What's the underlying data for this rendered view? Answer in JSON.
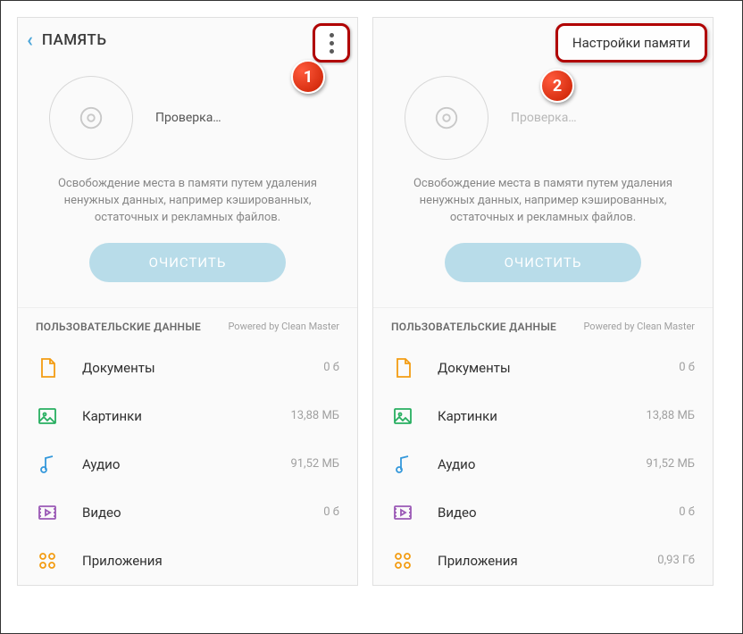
{
  "callouts": {
    "one": "1",
    "two": "2"
  },
  "left": {
    "header": {
      "title": "ПАМЯТЬ"
    },
    "status": "Проверка…",
    "description": "Освобождение места в памяти путем удаления ненужных данных, например кэшированных, остаточных и рекламных файлов.",
    "clean_button": "ОЧИСТИТЬ",
    "section": {
      "title": "ПОЛЬЗОВАТЕЛЬСКИЕ ДАННЫЕ",
      "powered": "Powered by Clean Master"
    },
    "items": [
      {
        "label": "Документы",
        "size": "0 б"
      },
      {
        "label": "Картинки",
        "size": "13,88 МБ"
      },
      {
        "label": "Аудио",
        "size": "91,52 МБ"
      },
      {
        "label": "Видео",
        "size": "0 б"
      },
      {
        "label": "Приложения",
        "size": ""
      }
    ]
  },
  "right": {
    "menu_item": "Настройки памяти",
    "status": "Проверка…",
    "description": "Освобождение места в памяти путем удаления ненужных данных, например кэшированных, остаточных и рекламных файлов.",
    "clean_button": "ОЧИСТИТЬ",
    "section": {
      "title": "ПОЛЬЗОВАТЕЛЬСКИЕ ДАННЫЕ",
      "powered": "Powered by Clean Master"
    },
    "items": [
      {
        "label": "Документы",
        "size": "0 б"
      },
      {
        "label": "Картинки",
        "size": "13,88 МБ"
      },
      {
        "label": "Аудио",
        "size": "91,52 МБ"
      },
      {
        "label": "Видео",
        "size": "0 б"
      },
      {
        "label": "Приложения",
        "size": "0,93 Гб"
      }
    ]
  }
}
